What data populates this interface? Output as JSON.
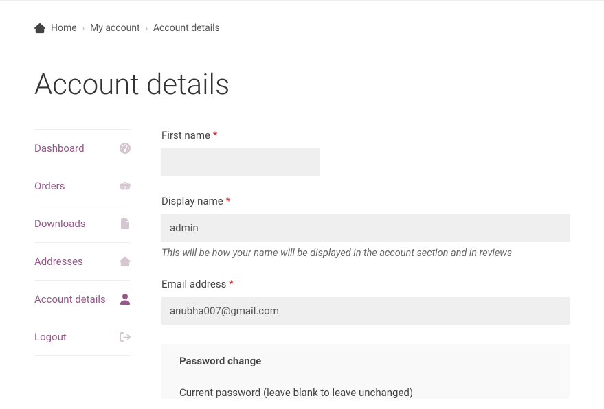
{
  "breadcrumb": {
    "home": "Home",
    "myaccount": "My account",
    "current": "Account details"
  },
  "page_title": "Account details",
  "sidebar": {
    "items": [
      {
        "label": "Dashboard"
      },
      {
        "label": "Orders"
      },
      {
        "label": "Downloads"
      },
      {
        "label": "Addresses"
      },
      {
        "label": "Account details"
      },
      {
        "label": "Logout"
      }
    ]
  },
  "form": {
    "first_name_label": "First name",
    "first_name_value": "",
    "display_name_label": "Display name",
    "display_name_value": "admin",
    "display_name_hint": "This will be how your name will be displayed in the account section and in reviews",
    "email_label": "Email address",
    "email_value": "anubha007@gmail.com",
    "password_legend": "Password change",
    "current_password_label": "Current password (leave blank to leave unchanged)"
  }
}
